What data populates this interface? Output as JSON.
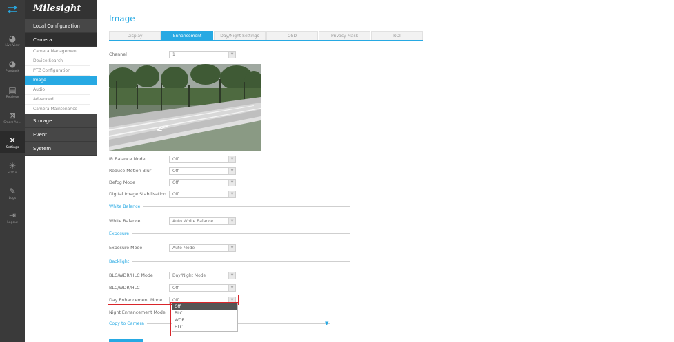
{
  "rail": {
    "items": [
      {
        "icon": "live-view-icon",
        "label": "Live View"
      },
      {
        "icon": "playback-icon",
        "label": "Playback"
      },
      {
        "icon": "retrieve-icon",
        "label": "Retrieve"
      },
      {
        "icon": "smart-analysis-icon",
        "label": "Smart An..."
      },
      {
        "icon": "settings-icon",
        "label": "Settings"
      },
      {
        "icon": "status-icon",
        "label": "Status"
      },
      {
        "icon": "logs-icon",
        "label": "Logs"
      },
      {
        "icon": "logout-icon",
        "label": "Logout"
      }
    ]
  },
  "menu": {
    "logo": "Milesight",
    "local_configuration": "Local Configuration",
    "camera": "Camera",
    "camera_items": [
      "Camera Management",
      "Device Search",
      "PTZ Configuration",
      "Image",
      "Audio",
      "Advanced",
      "Camera Maintenance"
    ],
    "storage": "Storage",
    "event": "Event",
    "system": "System"
  },
  "page": {
    "title": "Image",
    "tabs": [
      "Display",
      "Enhancement",
      "Day/Night Settings",
      "OSD",
      "Privacy Mask",
      "ROI"
    ]
  },
  "form": {
    "channel": {
      "label": "Channel",
      "value": "1"
    },
    "ir_balance": {
      "label": "IR Balance Mode",
      "value": "Off"
    },
    "reduce_motion_blur": {
      "label": "Reduce Motion Blur",
      "value": "Off"
    },
    "defog": {
      "label": "Defog Mode",
      "value": "Off"
    },
    "dis": {
      "label": "Digital Image Stabilisation",
      "value": "Off"
    },
    "white_balance_section": "White Balance",
    "white_balance": {
      "label": "White Balance",
      "value": "Auto White Balance"
    },
    "exposure_section": "Exposure",
    "exposure_mode": {
      "label": "Exposure Mode",
      "value": "Auto Mode"
    },
    "backlight_section": "Backlight",
    "blc_mode": {
      "label": "BLC/WDR/HLC Mode",
      "value": "Day/Night Mode"
    },
    "blc": {
      "label": "BLC/WDR/HLC",
      "value": "Off"
    },
    "day_enh": {
      "label": "Day Enhancement Mode",
      "value": "Off"
    },
    "night_enh": {
      "label": "Night Enhancement Mode"
    },
    "copy_to_camera": "Copy to Camera",
    "dropdown_options": [
      "Off",
      "BLC",
      "WDR",
      "HLC"
    ]
  },
  "colors": {
    "accent": "#27a9e3",
    "highlight": "#d9252a",
    "rail": "#3a3a3a",
    "menu_dark": "#474747"
  }
}
